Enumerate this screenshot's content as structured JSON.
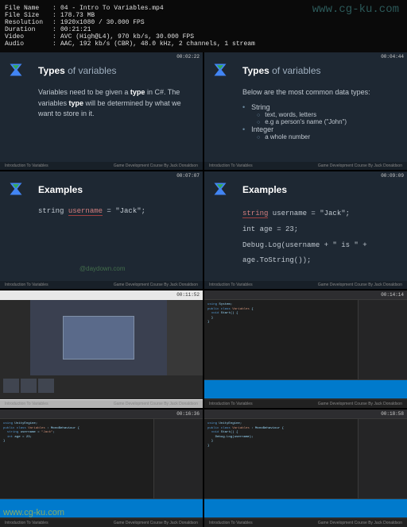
{
  "metadata": {
    "labels": {
      "fileName": "File Name",
      "fileSize": "File Size",
      "resolution": "Resolution",
      "duration": "Duration",
      "video": "Video",
      "audio": "Audio"
    },
    "fileName": "04 - Intro To Variables.mp4",
    "fileSize": "178.73 MB",
    "resolution": "1920x1080 / 30.000 FPS",
    "duration": "00:21:21",
    "video": "AVC (High@L4), 970 kb/s, 30.000 FPS",
    "audio": "AAC, 192 kb/s (CBR), 48.0 kHz, 2 channels, 1 stream"
  },
  "watermark": {
    "top": "www.cg-ku.com",
    "center": "@daydown.com",
    "bottom": "www.cg-ku.com"
  },
  "course": {
    "section": "Introduction To Variables",
    "credit": "Game Development Course By Jack Donaldson"
  },
  "tiles": [
    {
      "timestamp": "00:02:22",
      "title": "Types",
      "titleLight": " of variables",
      "body": "Variables need to be given a <b>type</b> in C#. The variables <b>type</b> will be determined by what we want to store in it."
    },
    {
      "timestamp": "00:04:44",
      "title": "Types",
      "titleLight": " of variables",
      "listIntro": "Below are the most common data types:",
      "items": [
        {
          "name": "String",
          "subs": [
            "text, words, letters",
            "e.g a person's name (\"John\")"
          ]
        },
        {
          "name": "Integer",
          "subs": [
            "a whole number"
          ]
        }
      ]
    },
    {
      "timestamp": "00:07:07",
      "title": "Examples",
      "codeLines": [
        "string username = \"Jack\";"
      ]
    },
    {
      "timestamp": "00:09:09",
      "title": "Examples",
      "codeLines": [
        "string username = \"Jack\";",
        "int age = 23;",
        "Debug.Log(username + \" is \" + age.ToString());"
      ]
    },
    {
      "timestamp": "00:11:52",
      "type": "unity"
    },
    {
      "timestamp": "00:14:14",
      "type": "ide"
    },
    {
      "timestamp": "00:16:36",
      "type": "ide"
    },
    {
      "timestamp": "00:18:58",
      "type": "ide"
    }
  ]
}
